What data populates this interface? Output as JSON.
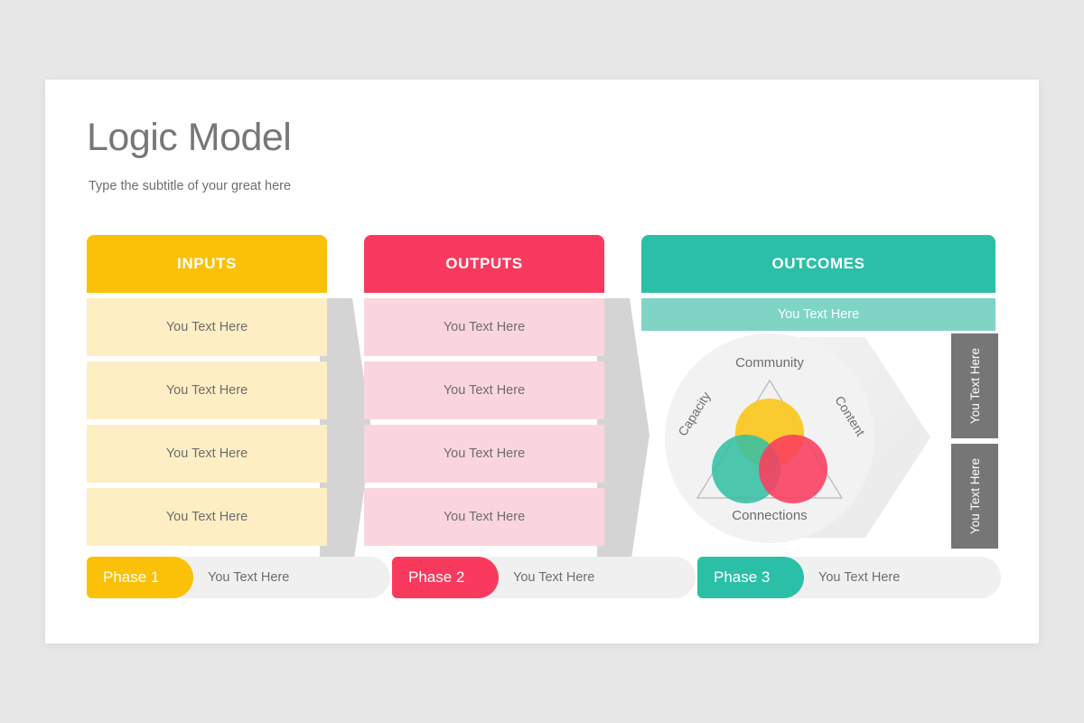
{
  "theme": {
    "page_background": "#e8e7e8",
    "card_background": "#ffffff",
    "yellow": "#fbc108",
    "yellow_light": "#fdeec4",
    "pink": "#f93a5e",
    "pink_light": "#fbd5de",
    "teal": "#2cbfa8",
    "teal_light": "#7fd4c6",
    "gray_tab": "#767676",
    "gray_arrow": "#d4d4d4",
    "text_gray": "#6d6d6d"
  },
  "header": {
    "title": "Logic Model",
    "subtitle": "Type the subtitle of your great here"
  },
  "columns": [
    {
      "id": "inputs",
      "header": "INPUTS",
      "rows": [
        "You Text Here",
        "You Text Here",
        "You Text Here",
        "You Text Here"
      ]
    },
    {
      "id": "outputs",
      "header": "OUTPUTS",
      "rows": [
        "You Text Here",
        "You Text Here",
        "You Text Here",
        "You Text Here"
      ]
    },
    {
      "id": "outcomes",
      "header": "OUTCOMES",
      "subbar": "You Text Here"
    }
  ],
  "venn": {
    "top_label": "Community",
    "left_label": "Capacity",
    "right_label": "Content",
    "bottom_label": "Connections",
    "circles": [
      {
        "name": "top-circle",
        "color": "#fbc81e"
      },
      {
        "name": "bottom-left-circle",
        "color": "#35bfa4"
      },
      {
        "name": "bottom-right-circle",
        "color": "#fa3c5f"
      }
    ]
  },
  "side_tabs": [
    {
      "label": "You Text Here"
    },
    {
      "label": "You Text Here"
    }
  ],
  "phases": [
    {
      "pill": "Phase 1",
      "text": "You Text Here"
    },
    {
      "pill": "Phase 2",
      "text": "You Text Here"
    },
    {
      "pill": "Phase 3",
      "text": "You Text Here"
    }
  ]
}
